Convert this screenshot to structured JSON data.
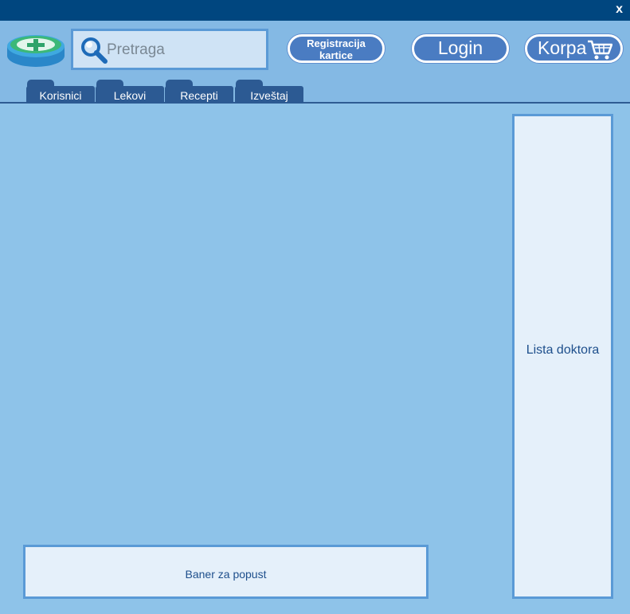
{
  "window": {
    "close_label": "x"
  },
  "header": {
    "logo": {
      "icon": "pharmacy-logo-icon"
    },
    "search": {
      "placeholder": "Pretraga",
      "icon": "search-icon"
    },
    "buttons": {
      "register_card": "Registracija kartice",
      "login": "Login",
      "cart": "Korpa",
      "cart_icon": "cart-icon"
    },
    "tabs": [
      {
        "label": "Korisnici"
      },
      {
        "label": "Lekovi"
      },
      {
        "label": "Recepti"
      },
      {
        "label": "Izveštaj"
      }
    ]
  },
  "main": {
    "doctors_list_label": "Lista doktora",
    "discount_banner_label": "Baner za popust"
  },
  "colors": {
    "titlebar": "#00467f",
    "background": "#8ec3e9",
    "header": "#84b9e4",
    "accent": "#4a7cc2",
    "tab": "#2c5a93",
    "panel": "#e5f0fa",
    "panel_border": "#5a9ad6"
  }
}
